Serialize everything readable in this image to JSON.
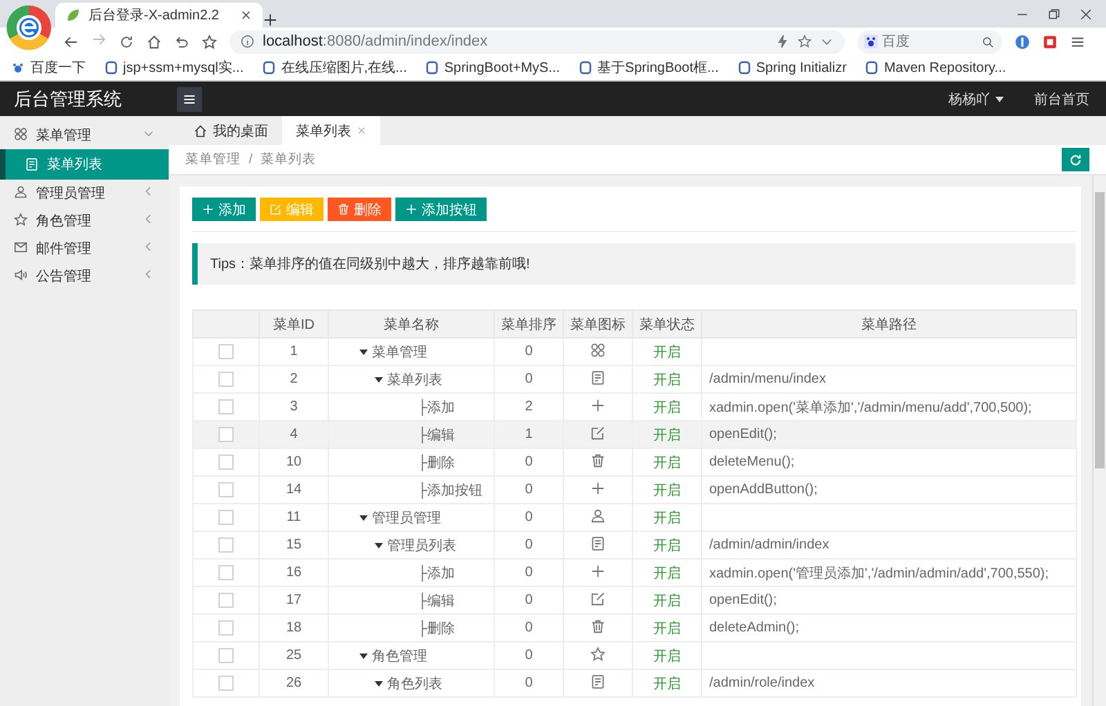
{
  "browser": {
    "tab_title": "后台登录-X-admin2.2",
    "address": "**localhost**:8080/admin/index/index",
    "search": {
      "placeholder": "百度"
    },
    "bookmarks": [
      "百度一下",
      "jsp+ssm+mysql实...",
      "在线压缩图片,在线...",
      "SpringBoot+MyS...",
      "基于SpringBoot框...",
      "Spring Initializr",
      "Maven Repository..."
    ]
  },
  "header": {
    "title": "后台管理系统",
    "user": "杨杨吖",
    "link": "前台首页"
  },
  "sidebar": {
    "items": [
      {
        "label": "菜单管理",
        "expanded": true,
        "children": [
          {
            "label": "菜单列表",
            "selected": true
          }
        ]
      },
      {
        "label": "管理员管理",
        "expanded": false
      },
      {
        "label": "角色管理",
        "expanded": false
      },
      {
        "label": "邮件管理",
        "expanded": false
      },
      {
        "label": "公告管理",
        "expanded": false
      }
    ]
  },
  "tabs": [
    {
      "label": "我的桌面",
      "selected": false,
      "closable": false
    },
    {
      "label": "菜单列表",
      "selected": true,
      "closable": true
    }
  ],
  "breadcrumb": {
    "items": [
      "菜单管理",
      "菜单列表"
    ],
    "separator": "/"
  },
  "buttons": [
    {
      "label": "添加",
      "color": "#009688"
    },
    {
      "label": "编辑",
      "color": "#ffb800"
    },
    {
      "label": "删除",
      "color": "#ff5722"
    },
    {
      "label": "添加按钮",
      "color": "#009688"
    }
  ],
  "tips": "Tips：菜单排序的值在同级别中越大，排序越靠前哦!",
  "table": {
    "columns": [
      "菜单ID",
      "菜单名称",
      "菜单排序",
      "菜单图标",
      "菜单状态",
      "菜单路径"
    ],
    "rows": [
      {
        "id": "1",
        "name": "菜单管理",
        "sort": "0",
        "kind": "grid",
        "status": "开启",
        "path": "",
        "checked": false,
        "selected": false,
        "expanded": true,
        "children": [
          {
            "id": "2",
            "name": "菜单列表",
            "sort": "0",
            "kind": "doc",
            "status": "开启",
            "path": "/admin/menu/index",
            "checked": false,
            "selected": false,
            "expanded": true,
            "children": [
              {
                "id": "3",
                "name": "├添加",
                "sort": "2",
                "kind": "plus",
                "status": "开启",
                "path": "xadmin.open('菜单添加','/admin/menu/add',700,500);",
                "checked": false,
                "selected": false
              },
              {
                "id": "4",
                "name": "├编辑",
                "sort": "1",
                "kind": "edit",
                "status": "开启",
                "path": "openEdit();",
                "checked": false,
                "selected": true
              },
              {
                "id": "10",
                "name": "├删除",
                "sort": "0",
                "kind": "trash",
                "status": "开启",
                "path": "deleteMenu();",
                "checked": false,
                "selected": false
              },
              {
                "id": "14",
                "name": "├添加按钮",
                "sort": "0",
                "kind": "plus",
                "status": "开启",
                "path": "openAddButton();",
                "checked": false,
                "selected": false
              }
            ]
          }
        ]
      },
      {
        "id": "11",
        "name": "管理员管理",
        "sort": "0",
        "kind": "user",
        "status": "开启",
        "path": "",
        "checked": false,
        "selected": false,
        "expanded": true,
        "children": [
          {
            "id": "15",
            "name": "管理员列表",
            "sort": "0",
            "kind": "doc",
            "status": "开启",
            "path": "/admin/admin/index",
            "checked": false,
            "selected": false,
            "expanded": true,
            "children": [
              {
                "id": "16",
                "name": "├添加",
                "sort": "0",
                "kind": "plus",
                "status": "开启",
                "path": "xadmin.open('管理员添加','/admin/admin/add',700,550);",
                "checked": false,
                "selected": false
              },
              {
                "id": "17",
                "name": "├编辑",
                "sort": "0",
                "kind": "edit",
                "status": "开启",
                "path": "openEdit();",
                "checked": false,
                "selected": false
              },
              {
                "id": "18",
                "name": "├删除",
                "sort": "0",
                "kind": "trash",
                "status": "开启",
                "path": "deleteAdmin();",
                "checked": false,
                "selected": false
              }
            ]
          }
        ]
      },
      {
        "id": "25",
        "name": "角色管理",
        "sort": "0",
        "kind": "star",
        "status": "开启",
        "path": "",
        "checked": false,
        "selected": false,
        "expanded": true,
        "children": [
          {
            "id": "26",
            "name": "角色列表",
            "sort": "0",
            "kind": "doc",
            "status": "开启",
            "path": "/admin/role/index",
            "checked": false,
            "selected": false,
            "expanded": true
          }
        ]
      }
    ]
  }
}
